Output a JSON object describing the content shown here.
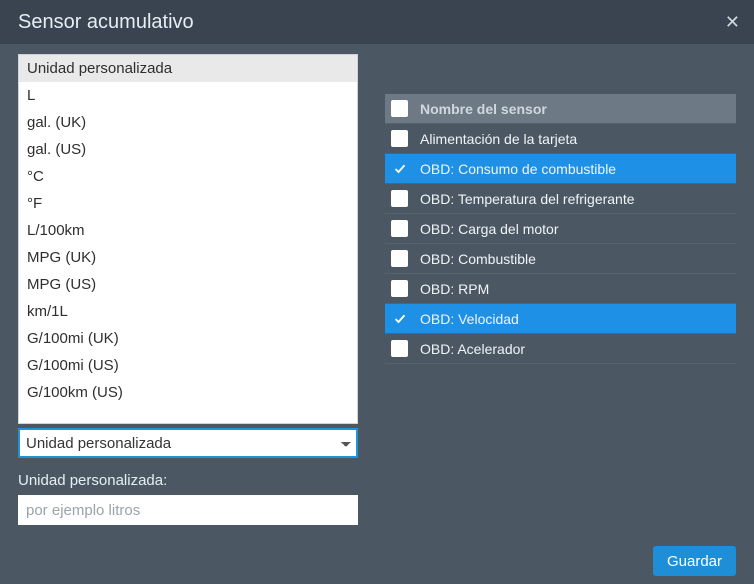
{
  "dialog": {
    "title": "Sensor acumulativo"
  },
  "units": {
    "options": [
      "Unidad personalizada",
      "L",
      "gal. (UK)",
      "gal. (US)",
      "°C",
      "°F",
      "L/100km",
      "MPG (UK)",
      "MPG (US)",
      "km/1L",
      "G/100mi (UK)",
      "G/100mi (US)",
      "G/100km (US)"
    ],
    "selected": "Unidad personalizada"
  },
  "custom_unit": {
    "label": "Unidad personalizada:",
    "placeholder": "por ejemplo litros",
    "value": ""
  },
  "sensors": {
    "header": "Nombre del sensor",
    "items": [
      {
        "label": "Alimentación de la tarjeta",
        "checked": false
      },
      {
        "label": "OBD: Consumo de combustible",
        "checked": true
      },
      {
        "label": "OBD: Temperatura del refrigerante",
        "checked": false
      },
      {
        "label": "OBD: Carga del motor",
        "checked": false
      },
      {
        "label": "OBD: Combustible",
        "checked": false
      },
      {
        "label": "OBD: RPM",
        "checked": false
      },
      {
        "label": "OBD: Velocidad",
        "checked": true
      },
      {
        "label": "OBD: Acelerador",
        "checked": false
      }
    ]
  },
  "footer": {
    "save_label": "Guardar"
  }
}
